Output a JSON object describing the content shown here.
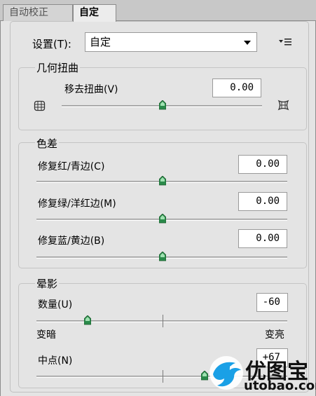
{
  "tabs": [
    {
      "label": "自动校正"
    },
    {
      "label": "自定"
    }
  ],
  "settings": {
    "label": "设置(T):",
    "value": "自定"
  },
  "geometric": {
    "title": "几何扭曲",
    "remove_distortion": {
      "label": "移去扭曲(V)",
      "value": "0.00",
      "level": 0.5
    }
  },
  "chromatic": {
    "title": "色差",
    "items": [
      {
        "label": "修复红/青边(C)",
        "value": "0.00",
        "level": 0.5
      },
      {
        "label": "修复绿/洋红边(M)",
        "value": "0.00",
        "level": 0.5
      },
      {
        "label": "修复蓝/黄边(B)",
        "value": "0.00",
        "level": 0.5
      }
    ]
  },
  "vignette": {
    "title": "晕影",
    "amount": {
      "label": "数量(U)",
      "value": "-60",
      "level": 0.2
    },
    "darken_label": "变暗",
    "lighten_label": "变亮",
    "midpoint": {
      "label": "中点(N)",
      "value": "+67",
      "level": 0.67
    }
  },
  "watermark": {
    "name": "优图宝",
    "url": "utobao.com"
  },
  "colors": {
    "thumb": "#2a8a4a",
    "brand_blue": "#1aa0e6"
  }
}
